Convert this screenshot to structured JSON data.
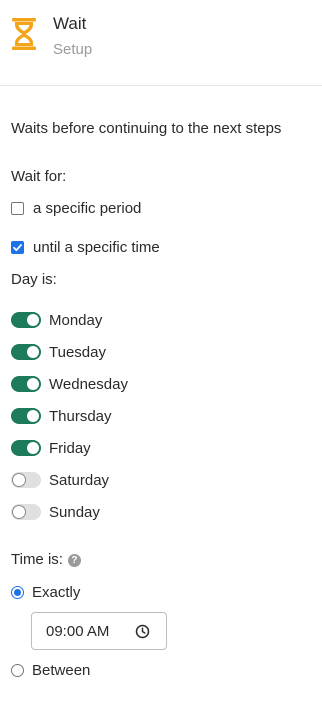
{
  "header": {
    "title": "Wait",
    "subtitle": "Setup",
    "icon": "hourglass-icon",
    "icon_color": "#f2a51a"
  },
  "description": "Waits before continuing to the next steps",
  "wait_for": {
    "label": "Wait for:",
    "options": [
      {
        "label": "a specific period",
        "checked": false
      },
      {
        "label": "until a specific time",
        "checked": true
      }
    ]
  },
  "day": {
    "label": "Day is:",
    "days": [
      {
        "label": "Monday",
        "enabled": true
      },
      {
        "label": "Tuesday",
        "enabled": true
      },
      {
        "label": "Wednesday",
        "enabled": true
      },
      {
        "label": "Thursday",
        "enabled": true
      },
      {
        "label": "Friday",
        "enabled": true
      },
      {
        "label": "Saturday",
        "enabled": false
      },
      {
        "label": "Sunday",
        "enabled": false
      }
    ]
  },
  "time": {
    "label": "Time is:",
    "help_icon": "?",
    "options": [
      {
        "label": "Exactly",
        "selected": true
      },
      {
        "label": "Between",
        "selected": false
      }
    ],
    "value": "09:00 AM"
  },
  "colors": {
    "toggle_on": "#1d7a5a",
    "accent": "#1a73e8"
  }
}
